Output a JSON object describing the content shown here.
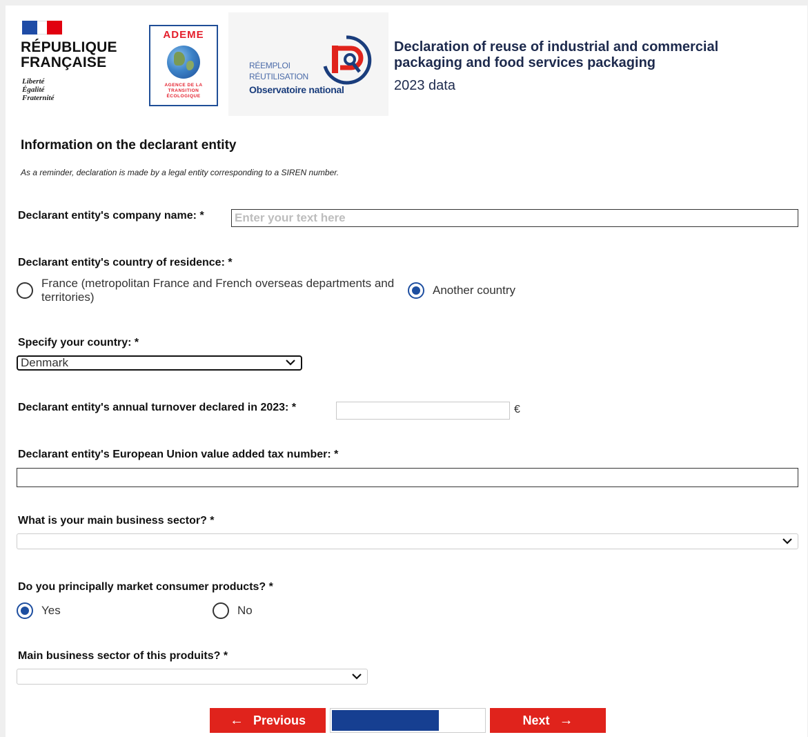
{
  "header": {
    "republique_line1": "RÉPUBLIQUE",
    "republique_line2": "FRANÇAISE",
    "motto_1": "Liberté",
    "motto_2": "Égalité",
    "motto_3": "Fraternité",
    "ademe_title": "ADEME",
    "ademe_sub_1": "AGENCE DE LA",
    "ademe_sub_2": "TRANSITION",
    "ademe_sub_3": "ÉCOLOGIQUE",
    "observatoire_line1": "RÉEMPLOI",
    "observatoire_line2": "RÉUTILISATION",
    "observatoire_line3": "Observatoire national",
    "title": "Declaration of reuse of industrial and commercial packaging and food services packaging",
    "subtitle": "2023 data"
  },
  "section": {
    "title": "Information on the declarant entity",
    "reminder": "As a reminder, declaration is made by a legal entity corresponding to a SIREN number."
  },
  "fields": {
    "company_name_label": "Declarant entity's company name: *",
    "company_name_placeholder": "Enter your text here",
    "company_name_value": "",
    "country_label": "Declarant entity's country of residence: *",
    "country_option_france": "France (metropolitan France and French overseas departments and territories)",
    "country_option_other": "Another country",
    "country_selected": "Another country",
    "specify_country_label": "Specify your country: *",
    "specify_country_value": "Denmark",
    "turnover_label": "Declarant entity's annual turnover declared in 2023: *",
    "turnover_value": "",
    "turnover_unit": "€",
    "vat_label": "Declarant entity's European Union value added tax number: *",
    "vat_value": "",
    "sector_label": "What is your main business sector? *",
    "sector_value": "",
    "consumer_label": "Do you principally market consumer products? *",
    "consumer_option_yes": "Yes",
    "consumer_option_no": "No",
    "consumer_selected": "Yes",
    "product_sector_label": "Main business sector of this produits? *",
    "product_sector_value": ""
  },
  "navigation": {
    "previous_label": "Previous",
    "next_label": "Next",
    "progress_fraction": 0.7
  },
  "colors": {
    "accent_red": "#e0231c",
    "progress_blue": "#163f91",
    "radio_blue": "#1d4ea0"
  }
}
